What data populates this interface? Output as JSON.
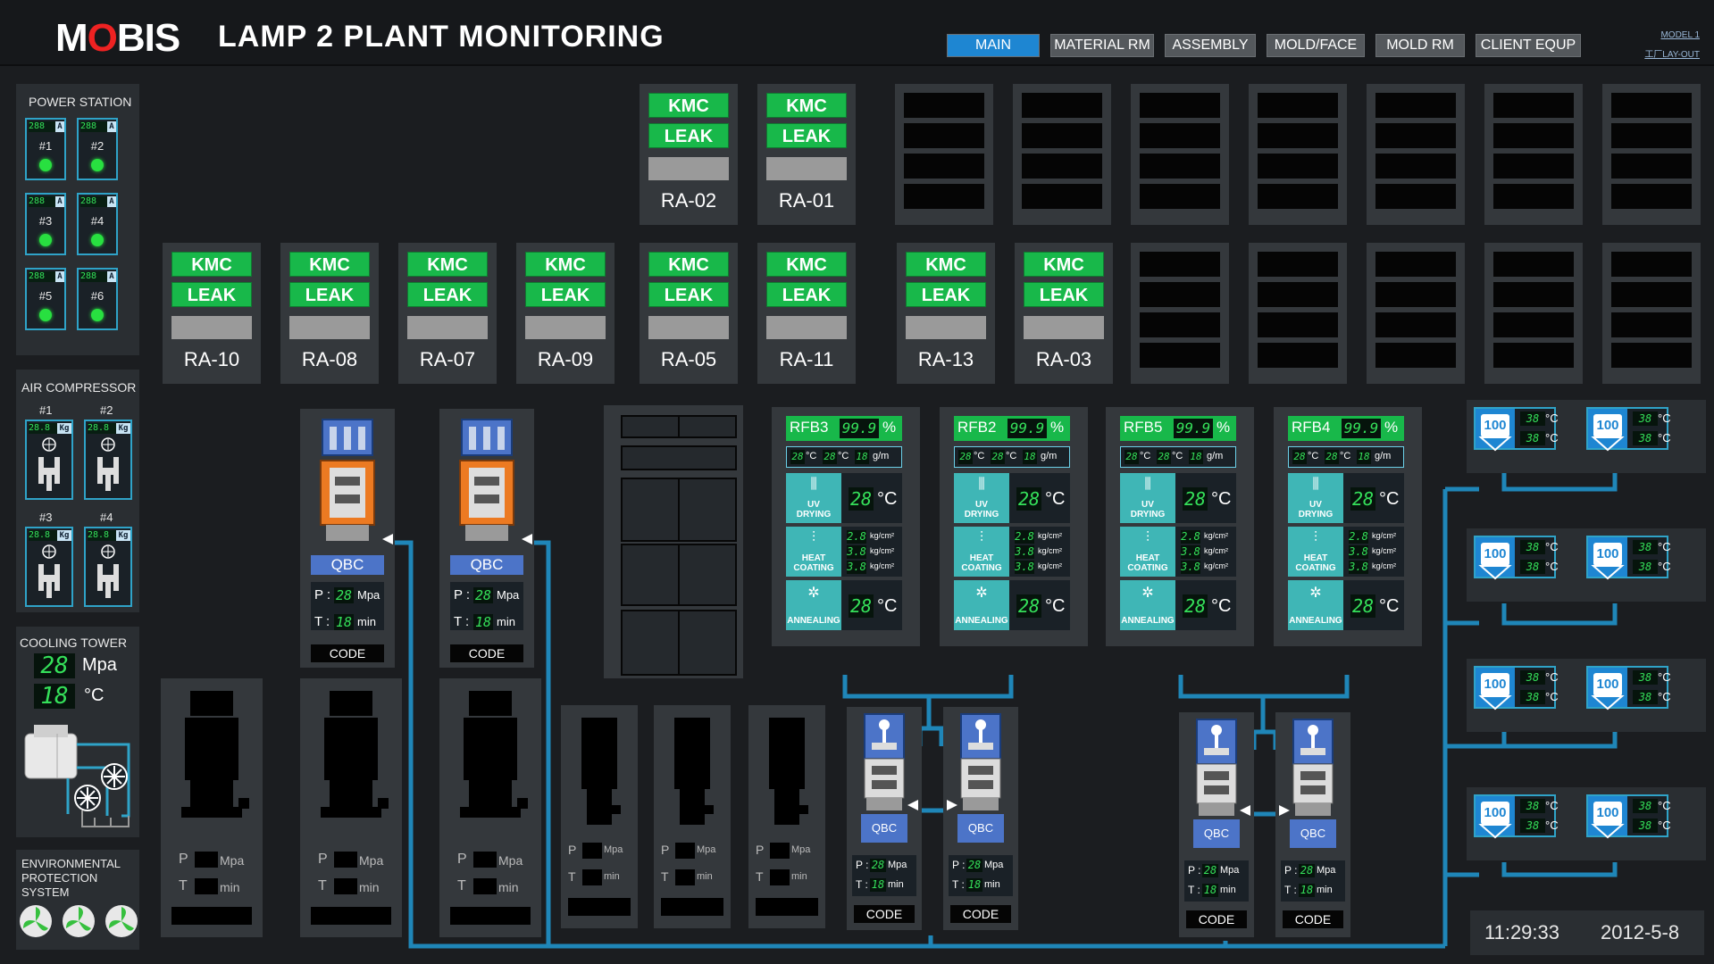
{
  "header": {
    "logo": "MOBIS",
    "title": "LAMP 2 PLANT  MONITORING",
    "nav": [
      "MAIN",
      "MATERIAL RM",
      "ASSEMBLY",
      "MOLD/FACE",
      "MOLD RM",
      "CLIENT EQUP"
    ],
    "model_link": "MODEL 1",
    "layout_link": "工厂LAY-OUT"
  },
  "power_station": {
    "title": "POWER STATION",
    "units": [
      {
        "label": "#1",
        "reading": "288",
        "unit": "A"
      },
      {
        "label": "#2",
        "reading": "288",
        "unit": "A"
      },
      {
        "label": "#3",
        "reading": "288",
        "unit": "A"
      },
      {
        "label": "#4",
        "reading": "288",
        "unit": "A"
      },
      {
        "label": "#5",
        "reading": "288",
        "unit": "A"
      },
      {
        "label": "#6",
        "reading": "288",
        "unit": "A"
      }
    ]
  },
  "air_compressor": {
    "title": "AIR COMPRESSOR",
    "units": [
      {
        "label": "#1",
        "reading": "28.8",
        "unit": "Kg"
      },
      {
        "label": "#2",
        "reading": "28.8",
        "unit": "Kg"
      },
      {
        "label": "#3",
        "reading": "28.8",
        "unit": "Kg"
      },
      {
        "label": "#4",
        "reading": "28.8",
        "unit": "Kg"
      }
    ]
  },
  "cooling_tower": {
    "title": "COOLING TOWER",
    "pressure": "28",
    "pressure_unit": "Mpa",
    "temp": "18",
    "temp_unit": "°C"
  },
  "env": {
    "title_l1": "ENVIRONMENTAL",
    "title_l2": "PROTECTION",
    "title_l3": "SYSTEM"
  },
  "ra_top": [
    {
      "l1": "KMC",
      "l2": "LEAK",
      "name": "RA-02"
    },
    {
      "l1": "KMC",
      "l2": "LEAK",
      "name": "RA-01"
    }
  ],
  "ra_row": [
    {
      "l1": "KMC",
      "l2": "LEAK",
      "name": "RA-10"
    },
    {
      "l1": "KMC",
      "l2": "LEAK",
      "name": "RA-08"
    },
    {
      "l1": "KMC",
      "l2": "LEAK",
      "name": "RA-07"
    },
    {
      "l1": "KMC",
      "l2": "LEAK",
      "name": "RA-09"
    },
    {
      "l1": "KMC",
      "l2": "LEAK",
      "name": "RA-05"
    },
    {
      "l1": "KMC",
      "l2": "LEAK",
      "name": "RA-11"
    },
    {
      "l1": "KMC",
      "l2": "LEAK",
      "name": "RA-13"
    },
    {
      "l1": "KMC",
      "l2": "LEAK",
      "name": "RA-03"
    }
  ],
  "qbc_big": [
    {
      "label": "QBC",
      "p_label": "P :",
      "p": "28",
      "p_unit": "Mpa",
      "t_label": "T :",
      "t": "18",
      "t_unit": "min",
      "code": "CODE"
    },
    {
      "label": "QBC",
      "p_label": "P :",
      "p": "28",
      "p_unit": "Mpa",
      "t_label": "T :",
      "t": "18",
      "t_unit": "min",
      "code": "CODE"
    }
  ],
  "dark_units": {
    "p_label": "P",
    "p_unit": "Mpa",
    "t_label": "T",
    "t_unit": "min"
  },
  "rfb": [
    {
      "name": "RFB3",
      "pct": "99.9",
      "pct_unit": "%",
      "t1": "28",
      "t2": "28",
      "flow": "18",
      "deg": "°C",
      "flow_unit": "g/m",
      "uv_l1": "UV",
      "uv_l2": "DRYING",
      "uv_temp": "28",
      "hc_l1": "HEAT",
      "hc_l2": "COATING",
      "hc_vals": [
        "2.8",
        "3.8",
        "3.8"
      ],
      "hc_unit": "kg/cm²",
      "an": "ANNEALING",
      "an_temp": "28"
    },
    {
      "name": "RFB2",
      "pct": "99.9",
      "pct_unit": "%",
      "t1": "28",
      "t2": "28",
      "flow": "18",
      "deg": "°C",
      "flow_unit": "g/m",
      "uv_l1": "UV",
      "uv_l2": "DRYING",
      "uv_temp": "28",
      "hc_l1": "HEAT",
      "hc_l2": "COATING",
      "hc_vals": [
        "2.8",
        "3.8",
        "3.8"
      ],
      "hc_unit": "kg/cm²",
      "an": "ANNEALING",
      "an_temp": "28"
    },
    {
      "name": "RFB5",
      "pct": "99.9",
      "pct_unit": "%",
      "t1": "28",
      "t2": "28",
      "flow": "18",
      "deg": "°C",
      "flow_unit": "g/m",
      "uv_l1": "UV",
      "uv_l2": "DRYING",
      "uv_temp": "28",
      "hc_l1": "HEAT",
      "hc_l2": "COATING",
      "hc_vals": [
        "2.8",
        "3.8",
        "3.8"
      ],
      "hc_unit": "kg/cm²",
      "an": "ANNEALING",
      "an_temp": "28"
    },
    {
      "name": "RFB4",
      "pct": "99.9",
      "pct_unit": "%",
      "t1": "28",
      "t2": "28",
      "flow": "18",
      "deg": "°C",
      "flow_unit": "g/m",
      "uv_l1": "UV",
      "uv_l2": "DRYING",
      "uv_temp": "28",
      "hc_l1": "HEAT",
      "hc_l2": "COATING",
      "hc_vals": [
        "2.8",
        "3.8",
        "3.8"
      ],
      "hc_unit": "kg/cm²",
      "an": "ANNEALING",
      "an_temp": "28"
    }
  ],
  "qbc_small": [
    {
      "label": "QBC",
      "p_label": "P :",
      "p": "28",
      "p_unit": "Mpa",
      "t_label": "T :",
      "t": "18",
      "t_unit": "min",
      "code": "CODE"
    },
    {
      "label": "QBC",
      "p_label": "P :",
      "p": "28",
      "p_unit": "Mpa",
      "t_label": "T :",
      "t": "18",
      "t_unit": "min",
      "code": "CODE"
    },
    {
      "label": "QBC",
      "p_label": "P :",
      "p": "28",
      "p_unit": "Mpa",
      "t_label": "T :",
      "t": "18",
      "t_unit": "min",
      "code": "CODE"
    },
    {
      "label": "QBC",
      "p_label": "P :",
      "p": "28",
      "p_unit": "Mpa",
      "t_label": "T :",
      "t": "18",
      "t_unit": "min",
      "code": "CODE"
    }
  ],
  "tanks": [
    {
      "level": "100",
      "t1": "38",
      "t2": "38",
      "unit": "°C"
    },
    {
      "level": "100",
      "t1": "38",
      "t2": "38",
      "unit": "°C"
    },
    {
      "level": "100",
      "t1": "38",
      "t2": "38",
      "unit": "°C"
    },
    {
      "level": "100",
      "t1": "38",
      "t2": "38",
      "unit": "°C"
    },
    {
      "level": "100",
      "t1": "38",
      "t2": "38",
      "unit": "°C"
    },
    {
      "level": "100",
      "t1": "38",
      "t2": "38",
      "unit": "°C"
    },
    {
      "level": "100",
      "t1": "38",
      "t2": "38",
      "unit": "°C"
    },
    {
      "level": "100",
      "t1": "38",
      "t2": "38",
      "unit": "°C"
    }
  ],
  "status": {
    "time": "11:29:33",
    "date": "2012-5-8"
  },
  "colors": {
    "accent": "#1e86d2",
    "ok_green": "#18b84a",
    "digit_green": "#35e05a",
    "pipe": "#1f86b8",
    "panel": "#34383c",
    "qbc_blue": "#4c74c8",
    "qbc_orange": "#ec7a22"
  },
  "icons": {
    "leds": "status-led-icon",
    "fan": "fan-icon",
    "pump": "pump-icon",
    "tank": "tank-icon"
  }
}
